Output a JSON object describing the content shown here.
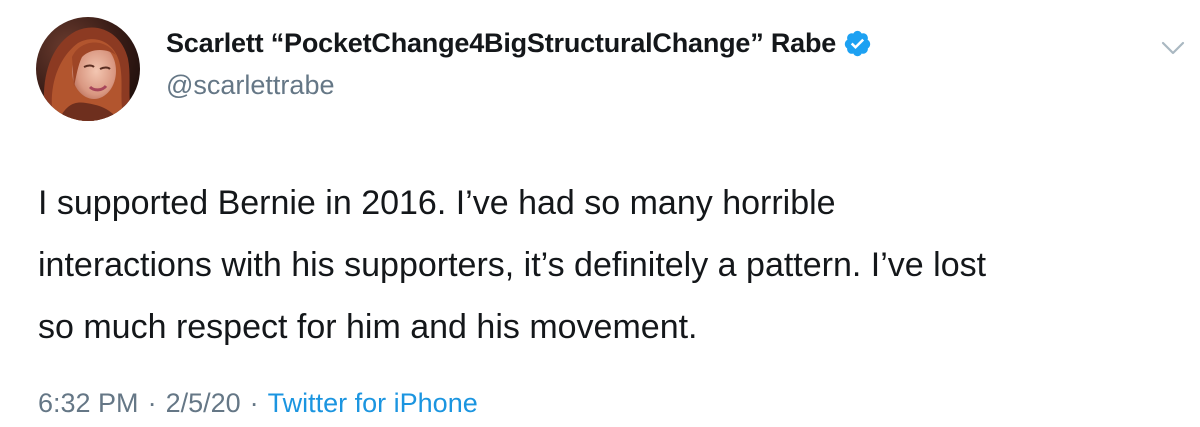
{
  "tweet": {
    "author": {
      "display_name": "Scarlett “PocketChange4BigStructuralChange” Rabe",
      "handle": "@scarlettrabe",
      "verified": true
    },
    "text_lines": [
      "I supported Bernie in 2016. I’ve had so many horrible",
      "interactions with his supporters, it’s definitely a pattern. I’ve lost",
      "so much respect for him and his movement."
    ],
    "meta": {
      "time": "6:32 PM",
      "separator": "·",
      "date": "2/5/20",
      "source": "Twitter for iPhone"
    }
  },
  "icons": {
    "avatar": "avatar-photo",
    "verified": "verified-badge-icon",
    "menu": "chevron-down-icon"
  },
  "colors": {
    "text": "#14171a",
    "secondary": "#657786",
    "link": "#1b95e0",
    "verified": "#1da1f2"
  }
}
